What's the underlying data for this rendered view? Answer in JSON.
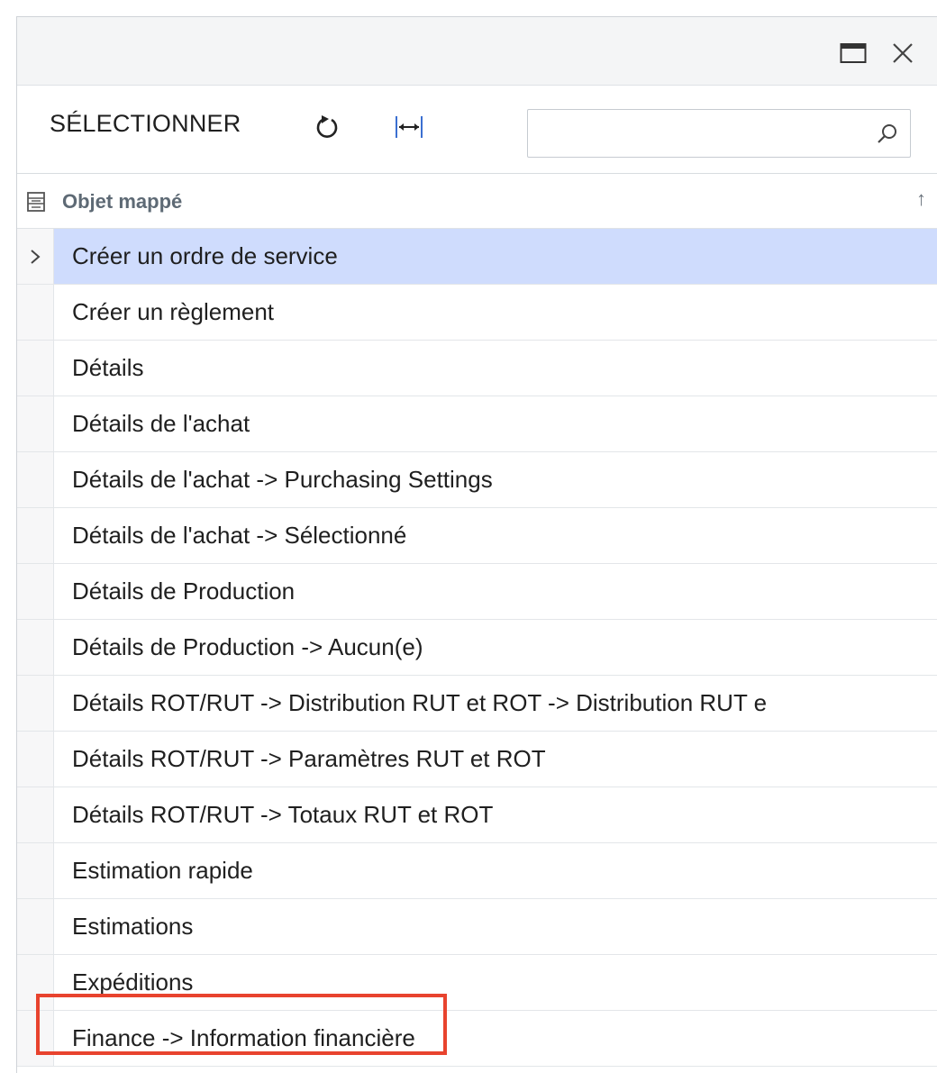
{
  "toolbar": {
    "select_label": "SÉLECTIONNER",
    "refresh_icon": "refresh-icon",
    "fit_icon": "fit-columns-icon",
    "search_value": "",
    "search_icon": "search-icon"
  },
  "window": {
    "maximize_icon": "maximize-icon",
    "close_icon": "close-icon"
  },
  "grid": {
    "column_header": "Objet mappé",
    "sort_indicator": "↑",
    "selected_row_index": 0,
    "rows": [
      "Créer un ordre de service",
      "Créer un règlement",
      "Détails",
      "Détails de l'achat",
      "Détails de l'achat -> Purchasing Settings",
      "Détails de l'achat -> Sélectionné",
      "Détails de Production",
      "Détails de Production -> Aucun(e)",
      "Détails ROT/RUT -> Distribution RUT et ROT -> Distribution RUT e",
      "Détails ROT/RUT -> Paramètres RUT et ROT",
      "Détails ROT/RUT -> Totaux RUT et ROT",
      "Estimation rapide",
      "Estimations",
      "Expéditions",
      "Finance -> Information financière"
    ]
  },
  "colors": {
    "selected_row": "#cfdcfd",
    "highlight": "#e8432e"
  }
}
